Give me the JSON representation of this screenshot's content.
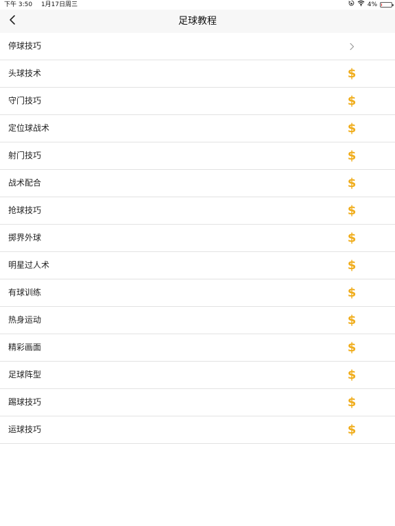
{
  "status_bar": {
    "time": "下午 3:50",
    "date": "1月17日周三",
    "battery_percent": "4%",
    "battery_level": 0.04,
    "icons": [
      "lock-rotation-icon",
      "wifi-icon",
      "battery-icon"
    ]
  },
  "nav": {
    "title": "足球教程",
    "back_icon": "chevron-left-icon"
  },
  "colors": {
    "coin": "#f0ad1c",
    "chevron": "#999999",
    "separator": "#e2e2e2",
    "navbar_bg": "#f7f7f7"
  },
  "list": {
    "items": [
      {
        "label": "停球技巧",
        "icon": "chevron-right-icon"
      },
      {
        "label": "头球技术",
        "icon": "coin-icon"
      },
      {
        "label": "守门技巧",
        "icon": "coin-icon"
      },
      {
        "label": "定位球战术",
        "icon": "coin-icon"
      },
      {
        "label": "射门技巧",
        "icon": "coin-icon"
      },
      {
        "label": "战术配合",
        "icon": "coin-icon"
      },
      {
        "label": "抢球技巧",
        "icon": "coin-icon"
      },
      {
        "label": "掷界外球",
        "icon": "coin-icon"
      },
      {
        "label": "明星过人术",
        "icon": "coin-icon"
      },
      {
        "label": "有球训练",
        "icon": "coin-icon"
      },
      {
        "label": "热身运动",
        "icon": "coin-icon"
      },
      {
        "label": "精彩画面",
        "icon": "coin-icon"
      },
      {
        "label": "足球阵型",
        "icon": "coin-icon"
      },
      {
        "label": "踢球技巧",
        "icon": "coin-icon"
      },
      {
        "label": "运球技巧",
        "icon": "coin-icon"
      }
    ]
  }
}
